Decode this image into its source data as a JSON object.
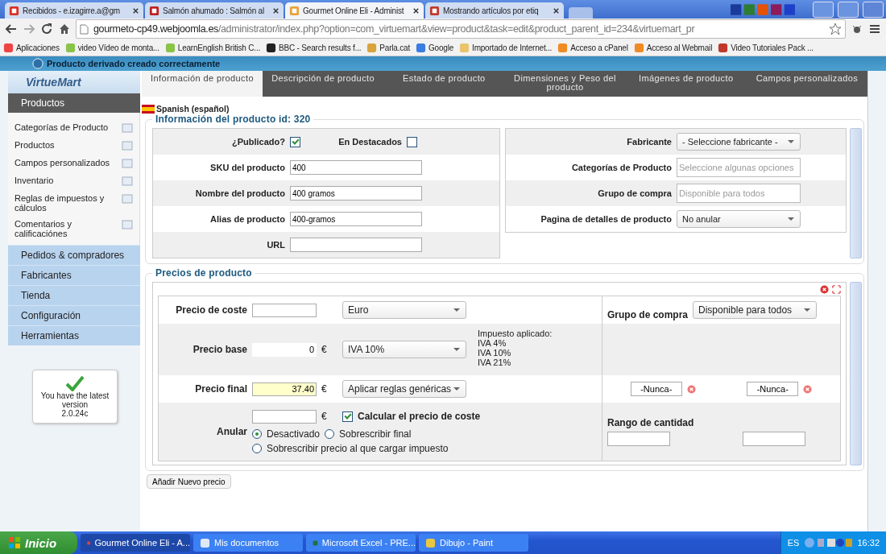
{
  "browser": {
    "tabs": [
      {
        "title": "Recibidos - e.izagirre.a@gm",
        "selected": false
      },
      {
        "title": "Salmón ahumado : Salmón al",
        "selected": false
      },
      {
        "title": "Gourmet Online Eli - Administ",
        "selected": true
      },
      {
        "title": "Mostrando artículos por etiq",
        "selected": false
      }
    ],
    "address": {
      "host": "gourmeto-cp49.webjoomla.es",
      "path": "/administrator/index.php?option=com_virtuemart&view=product&task=edit&product_parent_id=234&virtuemart_pr"
    },
    "bookmarks": [
      {
        "label": "Aplicaciones"
      },
      {
        "label": "video Vídeo de monta..."
      },
      {
        "label": "LearnEnglish  British C..."
      },
      {
        "label": "BBC - Search results f..."
      },
      {
        "label": "Parla.cat"
      },
      {
        "label": "Google"
      },
      {
        "label": "Importado de Internet..."
      },
      {
        "label": "Acceso a cPanel"
      },
      {
        "label": "Acceso al Webmail"
      },
      {
        "label": "Video Tutoriales Pack ..."
      }
    ]
  },
  "notice": "Producto derivado creado correctamente",
  "sidebar": {
    "logo": "VirtueMart",
    "header": "Productos",
    "items": [
      {
        "label": "Categorías de Producto"
      },
      {
        "label": "Productos"
      },
      {
        "label": "Campos personalizados"
      },
      {
        "label": "Inventario"
      },
      {
        "label": "Reglas de impuestos y cálculos"
      },
      {
        "label": "Comentarios y calificaciónes"
      }
    ],
    "sections": [
      {
        "label": "Pedidos & compradores"
      },
      {
        "label": "Fabricantes"
      },
      {
        "label": "Tienda"
      },
      {
        "label": "Configuración"
      },
      {
        "label": "Herramientas"
      }
    ],
    "version": {
      "message": "You have the latest version",
      "number": "2.0.24c"
    }
  },
  "tabs": [
    {
      "label": "Información de producto",
      "selected": true
    },
    {
      "label": "Descripción de producto",
      "selected": false
    },
    {
      "label": "Estado de producto",
      "selected": false
    },
    {
      "label": "Dimensiones y Peso del producto",
      "selected": false
    },
    {
      "label": "Imágenes de producto",
      "selected": false
    },
    {
      "label": "Campos personalizados",
      "selected": false
    }
  ],
  "language": "Spanish (español)",
  "info": {
    "title": "Información del producto id: 320",
    "published": {
      "label": "¿Publicado?",
      "checked": true
    },
    "featured": {
      "label": "En Destacados",
      "checked": false
    },
    "fields": [
      {
        "label": "SKU del producto",
        "value": "400"
      },
      {
        "label": "Nombre del producto",
        "value": "400 gramos"
      },
      {
        "label": "Alias de producto",
        "value": "400-gramos"
      },
      {
        "label": "URL"
      }
    ],
    "right": [
      {
        "kind": "select",
        "label": "Fabricante",
        "value": "- Seleccione fabricante -"
      },
      {
        "kind": "input",
        "label": "Categorías de Producto",
        "placeholder": "Seleccione algunas opciones"
      },
      {
        "kind": "input",
        "label": "Grupo de compra",
        "placeholder": "Disponible para todos"
      },
      {
        "kind": "select",
        "label": "Pagina de detalles de producto",
        "value": "No anular"
      }
    ]
  },
  "prices": {
    "title": "Precios de producto",
    "cost": {
      "label": "Precio de coste",
      "currency": "Euro"
    },
    "group": {
      "label": "Grupo de compra",
      "value": "Disponible para todos"
    },
    "base": {
      "label": "Precio base",
      "value": "0",
      "symbol": "€",
      "tax": "IVA 10%",
      "applied": [
        "Impuesto aplicado:",
        "IVA 4%",
        "IVA 10%",
        "IVA 21%"
      ]
    },
    "final": {
      "label": "Precio final",
      "value": "37.40",
      "symbol": "€",
      "rule": "Aplicar reglas genéricas",
      "dates": [
        "-Nunca-",
        "-Nunca-"
      ]
    },
    "override": {
      "label": "Anular",
      "symbol": "€",
      "calc": {
        "label": "Calcular el precio de coste",
        "checked": true
      },
      "options": [
        {
          "label": "Desactivado",
          "selected": true
        },
        {
          "label": "Sobrescribir final",
          "selected": false
        },
        {
          "label": "Sobrescribir precio al que cargar impuesto",
          "selected": false
        }
      ]
    },
    "range": {
      "label": "Rango de cantidad"
    },
    "add_button": "Añadir Nuevo precio"
  },
  "taskbar": {
    "start": "Inicio",
    "items": [
      {
        "label": "Gourmet Online Eli - A...",
        "selected": true
      },
      {
        "label": "Mis documentos",
        "selected": false
      },
      {
        "label": "Microsoft Excel - PRE...",
        "selected": false
      },
      {
        "label": "Dibujo - Paint",
        "selected": false
      }
    ],
    "language": "ES",
    "time": "16:32"
  }
}
